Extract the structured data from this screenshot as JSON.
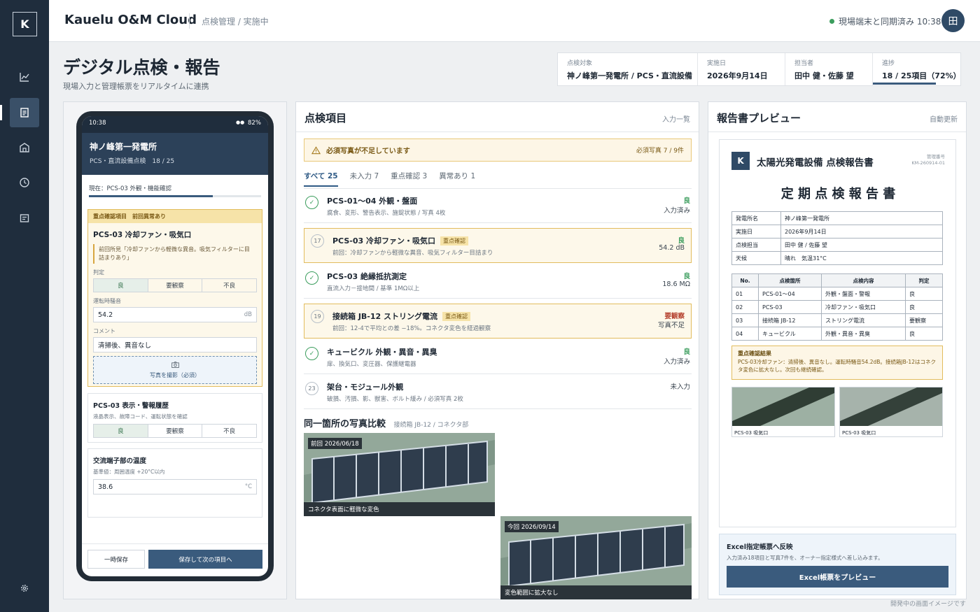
{
  "app": {
    "name": "Kauelu O&M Cloud",
    "logo_letter": "K",
    "breadcrumb": "点検管理 / 実施中",
    "sync_status": "現場端末と同期済み 10:38",
    "user_initial": "田"
  },
  "page": {
    "title": "デジタル点検・報告",
    "subtitle": "現場入力と管理帳票をリアルタイムに連携"
  },
  "meta": [
    {
      "label": "点検対象",
      "value": "神ノ峰第一発電所 / PCS・直流設備"
    },
    {
      "label": "実施日",
      "value": "2026年9月14日"
    },
    {
      "label": "担当者",
      "value": "田中 健・佐藤 望"
    },
    {
      "label": "進捗",
      "value": "18 / 25項目（72%）",
      "progress": 0.72
    }
  ],
  "phone": {
    "time": "10:38",
    "battery": "82%",
    "site": "神ノ峰第一発電所",
    "sub": "PCS・直流設備点検　18 / 25",
    "current": "現在：PCS-03 外観・機能確認",
    "progress": 0.72,
    "focus": {
      "banner": "重点確認項目　前回異常あり",
      "title": "PCS-03 冷却ファン・吸気口",
      "note": "前回所見「冷却ファンから軽微な異音。吸気フィルターに目詰まりあり」",
      "judge_label": "判定",
      "options": [
        "良",
        "要観察",
        "不良"
      ],
      "noise_label": "運転時騒音",
      "noise_value": "54.2",
      "noise_unit": "dB",
      "comment_label": "コメント",
      "comment_value": "清掃後、異音なし",
      "photo_label": "写真を撮影（必須）"
    },
    "card2": {
      "title": "PCS-03 表示・警報履歴",
      "desc": "液晶表示、故障コード、運転状態を確認",
      "options": [
        "良",
        "要観察",
        "不良"
      ]
    },
    "card3": {
      "title": "交流端子部の温度",
      "desc": "基準値：周囲温度 +20°C以内",
      "value": "38.6",
      "unit": "°C"
    },
    "save_temp": "一時保存",
    "save_next": "保存して次の項目へ"
  },
  "items_panel": {
    "title": "点検項目",
    "link": "入力一覧",
    "warning": "必須写真が不足しています",
    "warning_count": "必須写真 7 / 9件",
    "tabs": [
      "すべて 25",
      "未入力 7",
      "重点確認 3",
      "異常あり 1"
    ],
    "items": [
      {
        "mark": "✓",
        "title": "PCS-01〜04 外観・盤面",
        "tag": "",
        "desc": "腐食、変形、警告表示、施錠状態 / 写真 4枚",
        "status": "良",
        "value": "入力済み"
      },
      {
        "mark": "17",
        "title": "PCS-03 冷却ファン・吸気口",
        "tag": "重点確認",
        "desc": "前回：冷却ファンから軽微な異音、吸気フィルター目詰まり",
        "status": "良",
        "value": "54.2 dB"
      },
      {
        "mark": "✓",
        "title": "PCS-03 絶縁抵抗測定",
        "tag": "",
        "desc": "直流入力－接地間 / 基準 1MΩ以上",
        "status": "良",
        "value": "18.6 MΩ"
      },
      {
        "mark": "19",
        "title": "接続箱 JB-12 ストリング電流",
        "tag": "重点確認",
        "desc": "前回：12-4で平均との差 −18%。コネクタ変色を経過観察",
        "status": "要観察",
        "value": "写真不足"
      },
      {
        "mark": "✓",
        "title": "キュービクル 外観・異音・異臭",
        "tag": "",
        "desc": "扉、換気口、変圧器、保護継電器",
        "status": "良",
        "value": "入力済み"
      },
      {
        "mark": "23",
        "title": "架台・モジュール外観",
        "tag": "",
        "desc": "破損、汚損、影、獣害、ボルト緩み / 必須写真 2枚",
        "status": "",
        "value": "未入力"
      }
    ],
    "compare_title": "同一箇所の写真比較",
    "compare_sub": "接続箱 JB-12 / コネクタ部",
    "photos": [
      {
        "date": "前回 2026/06/18",
        "caption": "コネクタ表面に軽微な変色"
      },
      {
        "date": "今回 2026/09/14",
        "caption": "変色範囲に拡大なし"
      }
    ]
  },
  "report": {
    "title": "報告書プレビュー",
    "auto": "自動更新",
    "doc_title": "太陽光発電設備 点検報告書",
    "mgmt_label": "管理番号",
    "mgmt_no": "KM-260914-01",
    "heading": "定 期 点 検 報 告 書",
    "info": [
      [
        "発電所名",
        "神ノ峰第一発電所"
      ],
      [
        "実施日",
        "2026年9月14日"
      ],
      [
        "点検担当",
        "田中 健 / 佐藤 望"
      ],
      [
        "天候",
        "晴れ　気温31°C"
      ]
    ],
    "table_headers": [
      "No.",
      "点検箇所",
      "点検内容",
      "判定"
    ],
    "rows": [
      [
        "01",
        "PCS-01〜04",
        "外観・盤面・警報",
        "良"
      ],
      [
        "02",
        "PCS-03",
        "冷却ファン・吸気口",
        "良"
      ],
      [
        "03",
        "接続箱 JB-12",
        "ストリング電流",
        "要観察"
      ],
      [
        "04",
        "キュービクル",
        "外観・異音・異臭",
        "良"
      ]
    ],
    "result_title": "重点確認結果",
    "result_text": "PCS-03冷却ファン：清掃後、異音なし。運転時騒音54.2dB。接続箱JB-12はコネクタ変色に拡大なし。次回も継続確認。",
    "photo_captions": [
      "PCS-03 吸気口",
      "PCS-03 吸気口"
    ],
    "excel_title": "Excel指定帳票へ反映",
    "excel_desc": "入力済み18項目と写真7件を、オーナー指定様式へ差し込みます。",
    "excel_button": "Excel帳票をプレビュー"
  },
  "footer": "開発中の画面イメージです",
  "colors": {
    "accent": "#3a5b7d",
    "sidebar": "#1f2d3d",
    "ok": "#3b9d5d",
    "warn": "#b5412f",
    "highlight": "#fdf8ea"
  },
  "icons": {
    "sidebar": [
      "chart-icon",
      "document-icon",
      "building-icon",
      "clock-icon",
      "report-icon",
      "gear-icon"
    ]
  }
}
